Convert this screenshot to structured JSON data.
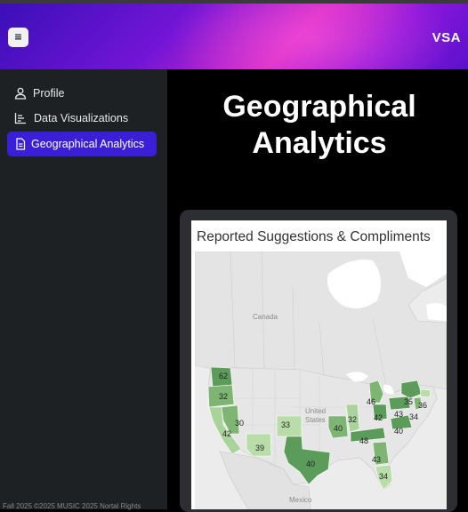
{
  "header": {
    "menu_icon": "≡",
    "brand": "VSA"
  },
  "sidebar": {
    "items": [
      {
        "label": "Profile",
        "icon": "user-icon",
        "active": false
      },
      {
        "label": "Data Visualizations",
        "icon": "bar-chart-icon",
        "active": false
      },
      {
        "label": "Geographical Analytics",
        "icon": "document-icon",
        "active": true
      }
    ]
  },
  "main": {
    "title": "Geographical Analytics"
  },
  "viz": {
    "title": "Reported Suggestions & Compliments",
    "map_labels": {
      "canada": "Canada",
      "us_line1": "United",
      "us_line2": "States",
      "mexico": "Mexico"
    },
    "state_values": {
      "WA": "62",
      "OR": "32",
      "CA": "42",
      "NV": "30",
      "AZ": "39",
      "CO": "33",
      "TX": "40",
      "MO": "40",
      "IL": "32",
      "MI": "46",
      "OH": "42",
      "PA": "43",
      "NY": "35",
      "NJ": "34",
      "MA": "36",
      "VA": "40",
      "TN": "48",
      "GA": "43",
      "FL": "34"
    },
    "colors": {
      "dark": "#5c9c5a",
      "mid": "#8bc27f",
      "light": "#b9dda8"
    }
  },
  "footer": {
    "text": "Fall 2025    ©2025 MUSIC   2025 Nortal Rights"
  }
}
